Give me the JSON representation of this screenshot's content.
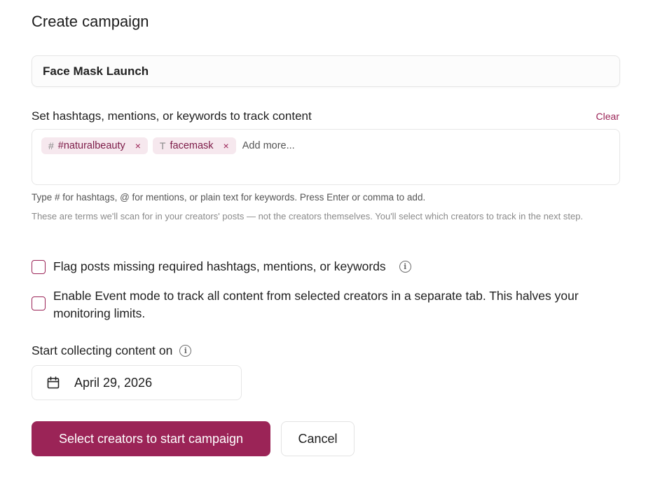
{
  "page": {
    "title": "Create campaign"
  },
  "campaign_name": {
    "value": "Face Mask Launch"
  },
  "tracking": {
    "label": "Set hashtags, mentions, or keywords to track content",
    "clear_label": "Clear",
    "chips": [
      {
        "icon_glyph": "#",
        "icon": "hashtag-icon",
        "text": "#naturalbeauty",
        "remove_glyph": "×"
      },
      {
        "icon_glyph": "T",
        "icon": "keyword-text-icon",
        "text": "facemask",
        "remove_glyph": "×"
      }
    ],
    "placeholder": "Add more...",
    "help_primary": "Type # for hashtags, @ for mentions, or plain text for keywords. Press Enter or comma to add.",
    "help_secondary": "These are terms we'll scan for in your creators' posts — not the creators themselves. You'll select which creators to track in the next step."
  },
  "options": {
    "flag_missing": {
      "label": "Flag posts missing required hashtags, mentions, or keywords",
      "checked": false,
      "info_glyph": "i"
    },
    "event_mode": {
      "label": "Enable Event mode to track all content from selected creators in a separate tab. This halves your monitoring limits.",
      "checked": false
    }
  },
  "start": {
    "label": "Start collecting content on",
    "info_glyph": "i",
    "date": "April 29, 2026"
  },
  "actions": {
    "primary_label": "Select creators to start campaign",
    "cancel_label": "Cancel"
  },
  "colors": {
    "accent": "#9b2457",
    "chip_bg": "#f6e8ee",
    "chip_text": "#7c1a47"
  }
}
